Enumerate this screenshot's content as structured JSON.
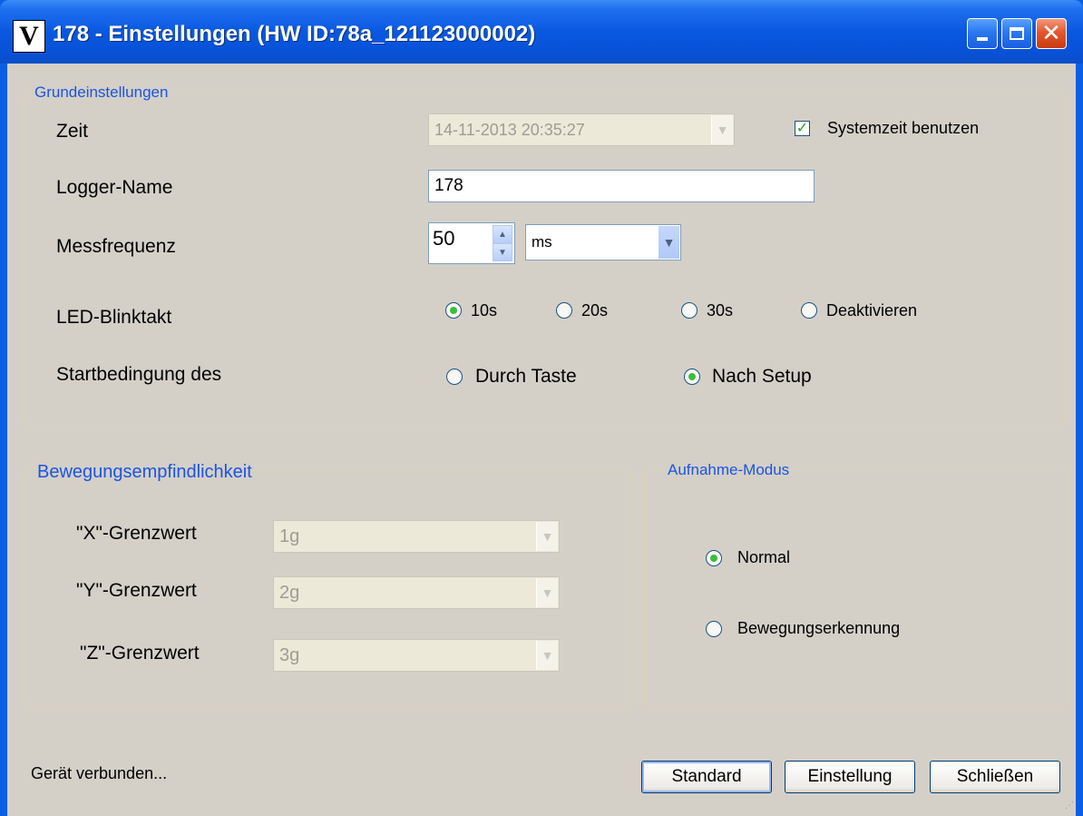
{
  "window": {
    "title": "178 - Einstellungen (HW ID:78a_121123000002)",
    "app_icon_glyph": "V",
    "icons": [
      "minimize-icon",
      "maximize-icon",
      "close-icon"
    ]
  },
  "grundeinstellungen": {
    "legend": "Grundeinstellungen",
    "zeit_label": "Zeit",
    "zeit_value": "14-11-2013 20:35:27",
    "systemzeit_label": "Systemzeit benutzen",
    "systemzeit_checked": true,
    "logger_label": "Logger-Name",
    "logger_value": "178",
    "mess_label": "Messfrequenz",
    "mess_value": "50",
    "mess_unit": "ms",
    "led_label": "LED-Blinktakt",
    "led_options": [
      "10s",
      "20s",
      "30s",
      "Deaktivieren"
    ],
    "led_selected": "10s",
    "start_label": "Startbedingung des",
    "start_options": [
      "Durch Taste",
      "Nach Setup"
    ],
    "start_selected": "Nach Setup"
  },
  "bewegung": {
    "legend": "Bewegungsempfindlichkeit",
    "x_label": "\"X\"-Grenzwert",
    "x_value": "1g",
    "y_label": "\"Y\"-Grenzwert",
    "y_value": "2g",
    "z_label": "\"Z\"-Grenzwert",
    "z_value": "3g"
  },
  "aufnahme": {
    "legend": "Aufnahme-Modus",
    "options": [
      "Normal",
      "Bewegungserkennung"
    ],
    "selected": "Normal"
  },
  "status": "Gerät verbunden...",
  "buttons": {
    "standard": "Standard",
    "einstellung": "Einstellung",
    "schliessen": "Schließen"
  },
  "colors": {
    "titlebar": "#0752d8",
    "dialog_bg": "#d4d0c8",
    "group_label": "#1b54e0",
    "radio_dot": "#3dbd3d"
  }
}
